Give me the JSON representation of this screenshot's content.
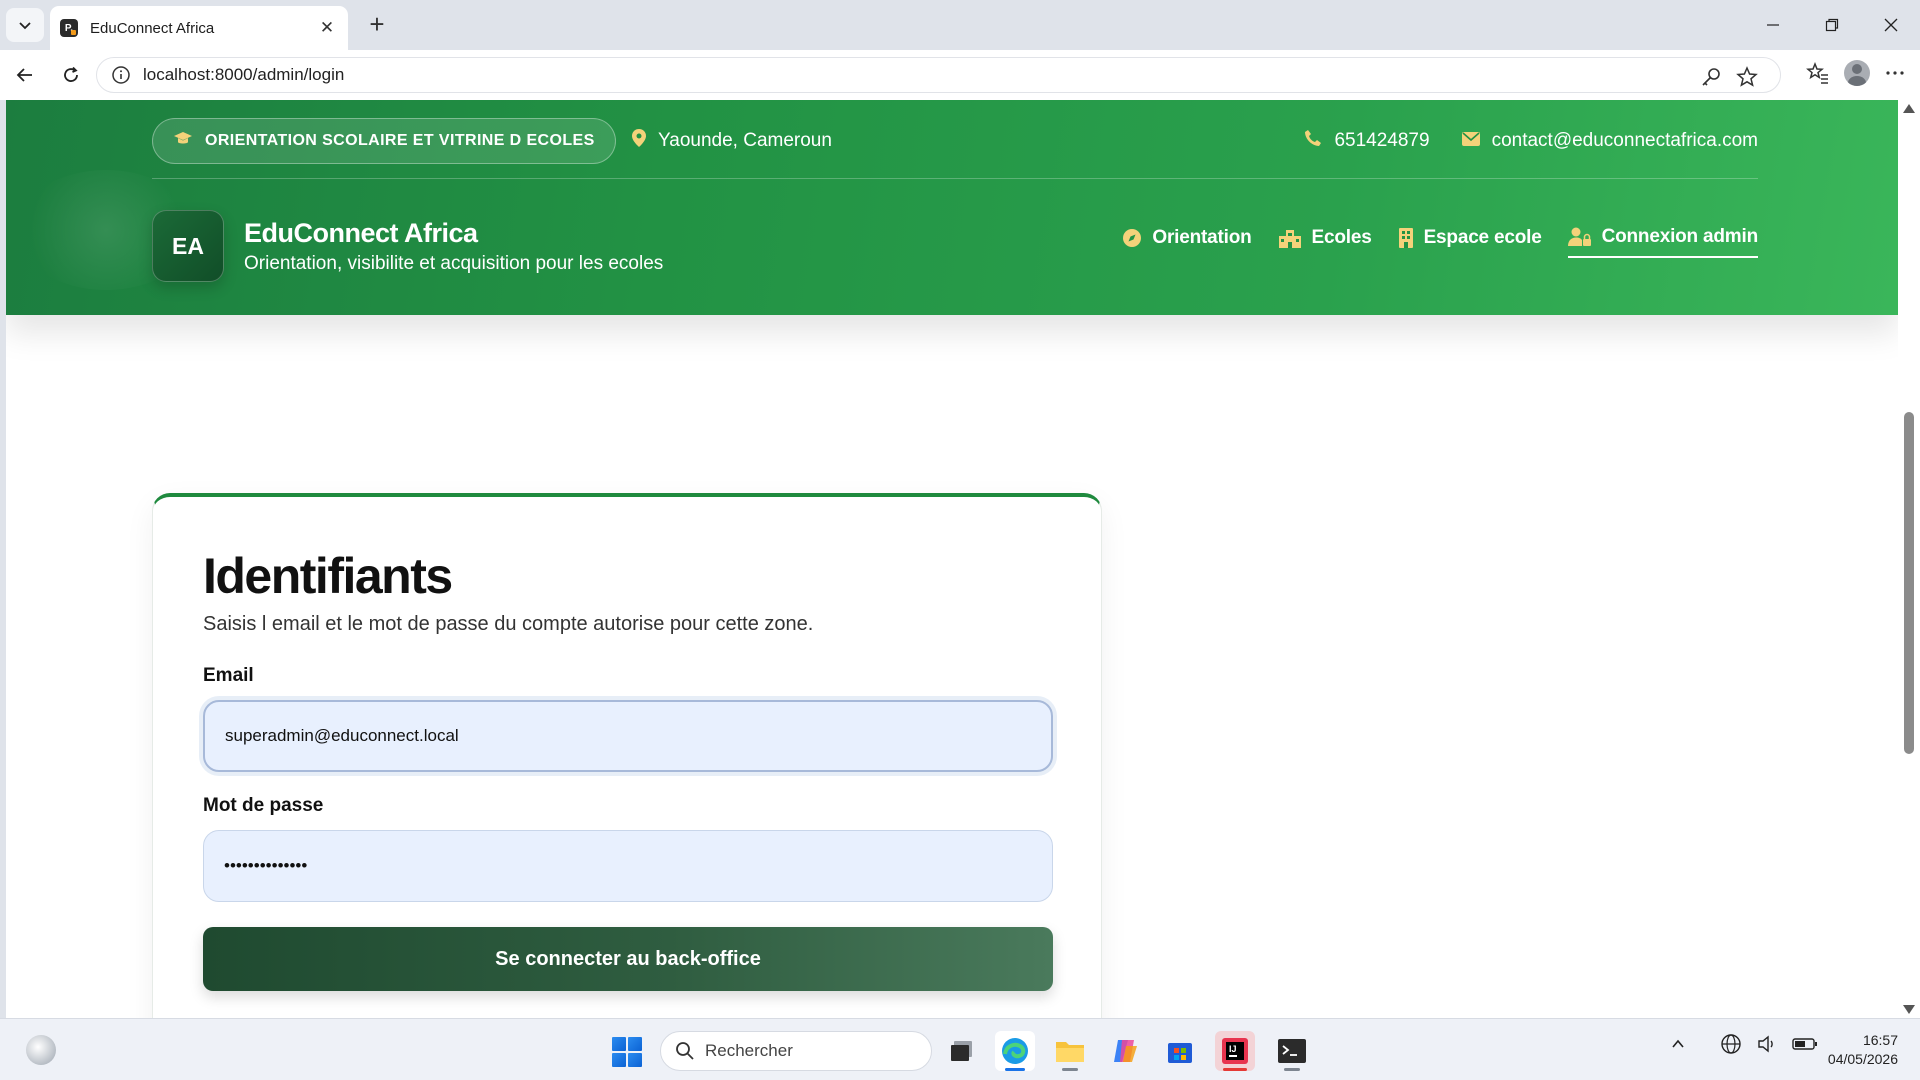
{
  "browser": {
    "tab_title": "EduConnect Africa",
    "tab_favicon_text": "P.",
    "url": "localhost:8000/admin/login"
  },
  "site": {
    "badge": "ORIENTATION SCOLAIRE ET VITRINE D ECOLES",
    "location": "Yaounde, Cameroun",
    "phone": "651424879",
    "email": "contact@educonnectafrica.com",
    "brand": {
      "logo_text": "EA",
      "name": "EduConnect Africa",
      "tagline": "Orientation, visibilite et acquisition pour les ecoles"
    },
    "nav": [
      {
        "label": "Orientation",
        "icon": "compass-icon"
      },
      {
        "label": "Ecoles",
        "icon": "buildings-icon"
      },
      {
        "label": "Espace ecole",
        "icon": "building-icon"
      },
      {
        "label": "Connexion admin",
        "icon": "user-lock-icon",
        "active": true
      }
    ]
  },
  "login": {
    "title": "Identifiants",
    "subtitle": "Saisis l email et le mot de passe du compte autorise pour cette zone.",
    "email_label": "Email",
    "email_value": "superadmin@educonnect.local",
    "password_label": "Mot de passe",
    "password_value": "••••••••••••••",
    "submit_label": "Se connecter au back-office"
  },
  "taskbar": {
    "search_placeholder": "Rechercher",
    "time": "16:57",
    "date": "04/05/2026"
  },
  "colors": {
    "header_green": "#229244",
    "accent_gold": "#f4d27a",
    "button_dark_green": "#1f4a30"
  }
}
